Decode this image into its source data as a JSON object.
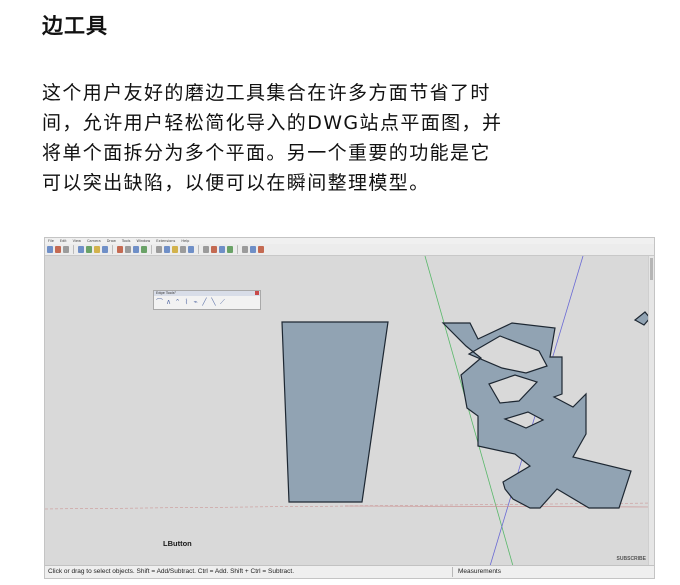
{
  "heading": "边工具",
  "description": {
    "lines": [
      "这个用户友好的磨边工具集合在许多方面节省了时",
      "间，允许用户轻松简化导入的DWG站点平面图，并",
      "将单个面拆分为多个平面。另一个重要的功能是它",
      "可以突出缺陷，以便可以在瞬间整理模型。"
    ]
  },
  "screenshot": {
    "menu": [
      "File",
      "Edit",
      "View",
      "Camera",
      "Draw",
      "Tools",
      "Window",
      "Extensions",
      "Help"
    ],
    "toolbar_icons": [
      "new-icon",
      "open-icon",
      "save-icon",
      "select-icon",
      "eraser-icon",
      "paint-icon",
      "line-icon",
      "arc-icon",
      "rectangle-icon",
      "push-pull-icon",
      "move-icon",
      "rotate-icon",
      "scale-icon",
      "orbit-icon",
      "pan-icon",
      "zoom-icon"
    ],
    "floating_toolbar": {
      "title": "Edge Tools²",
      "icons": [
        "edge-icon-1",
        "edge-icon-2",
        "edge-icon-3",
        "edge-icon-4",
        "edge-icon-5",
        "edge-icon-6",
        "edge-icon-7",
        "edge-icon-8"
      ]
    },
    "lbutton_label": "LButton",
    "subscribe_label": "SUBSCRIBE",
    "status_hint": "Click or drag to select objects. Shift = Add/Subtract. Ctrl = Add. Shift + Ctrl = Subtract.",
    "measurements_label": "Measurements",
    "colors": {
      "face_fill": "#91a3b3",
      "face_stroke": "#1d2732",
      "viewport_bg": "#d9d9d9",
      "axis_green": "#59b86a",
      "axis_blue": "#6a6ad4",
      "axis_red": "#c98a8a"
    }
  }
}
